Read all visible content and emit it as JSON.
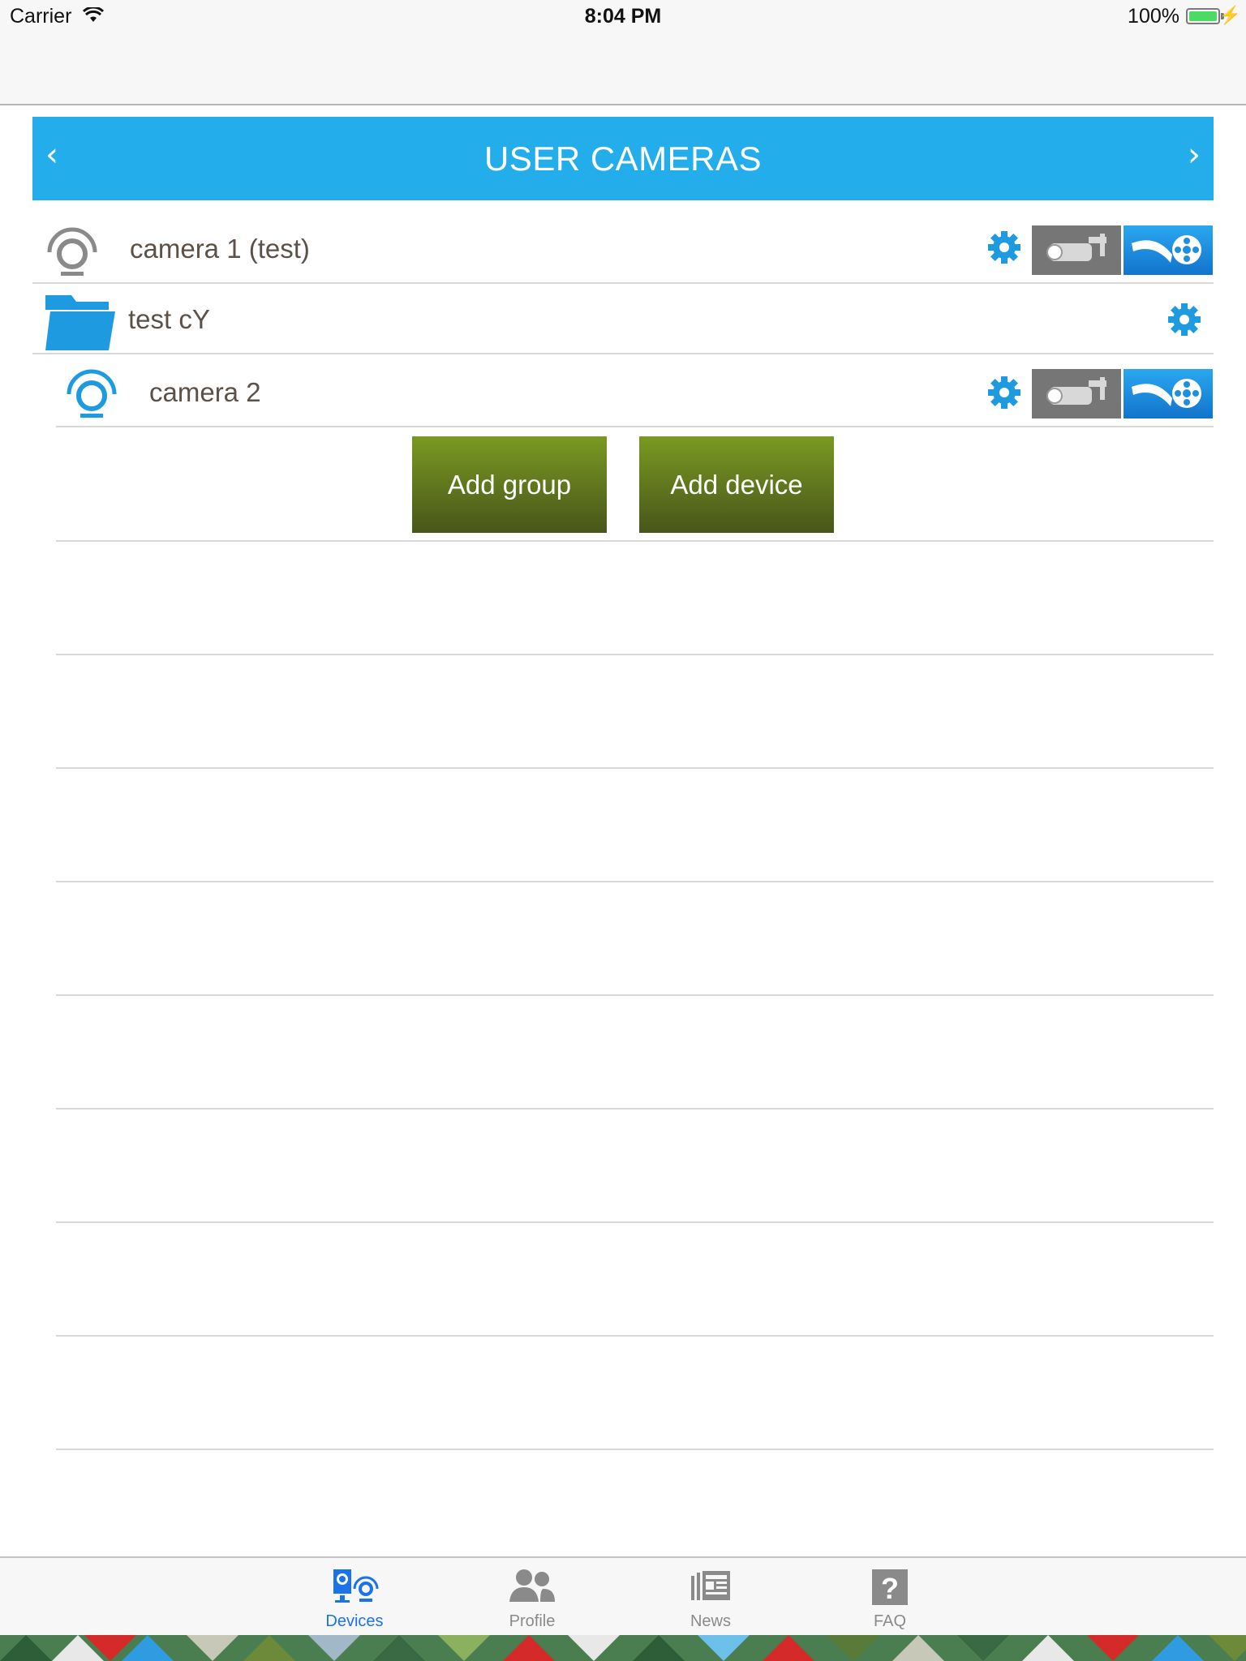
{
  "status_bar": {
    "carrier": "Carrier",
    "time": "8:04 PM",
    "battery": "100%"
  },
  "header": {
    "title": "USER CAMERAS",
    "prev_icon": "‹",
    "next_icon": "›"
  },
  "rows": [
    {
      "label": "camera 1 (test)",
      "icon": "camera-gray-icon"
    },
    {
      "label": "test cY",
      "icon": "folder-icon"
    },
    {
      "label": "camera 2",
      "icon": "camera-blue-icon"
    }
  ],
  "actions": {
    "add_group": "Add group",
    "add_device": "Add device"
  },
  "tabs": [
    {
      "label": "Devices",
      "icon": "devices-icon",
      "active": true
    },
    {
      "label": "Profile",
      "icon": "profile-icon",
      "active": false
    },
    {
      "label": "News",
      "icon": "news-icon",
      "active": false
    },
    {
      "label": "FAQ",
      "icon": "faq-icon",
      "active": false
    }
  ],
  "colors": {
    "header": "#23adea",
    "accent_blue": "#1e9be0",
    "button_olive": "#6a8320",
    "tab_active": "#1a73e8"
  }
}
